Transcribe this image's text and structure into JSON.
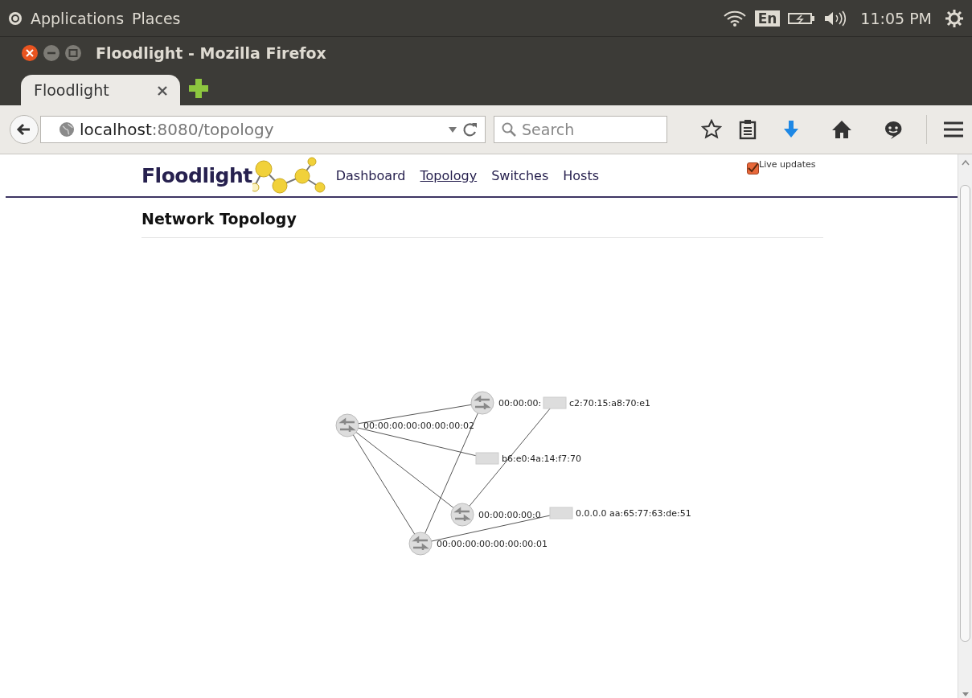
{
  "top_panel": {
    "menus": [
      "Applications",
      "Places"
    ],
    "keyboard": "En",
    "clock": "11:05 PM"
  },
  "window": {
    "title": "Floodlight - Mozilla Firefox"
  },
  "tabs": [
    {
      "label": "Floodlight",
      "selected": true
    }
  ],
  "url_bar": {
    "host": "localhost",
    "path": ":8080/topology"
  },
  "search": {
    "placeholder": "Search"
  },
  "page": {
    "logo": "Floodlight",
    "nav": [
      {
        "label": "Dashboard",
        "selected": false
      },
      {
        "label": "Topology",
        "selected": true
      },
      {
        "label": "Switches",
        "selected": false
      },
      {
        "label": "Hosts",
        "selected": false
      }
    ],
    "live_updates": {
      "label": "Live updates",
      "checked": true
    },
    "heading": "Network Topology",
    "topology": {
      "switches": [
        {
          "label": "00:00:00:00:00:00:00:02"
        },
        {
          "label": "00:00:00:"
        },
        {
          "label": "00:00:00:00:0"
        },
        {
          "label": "00:00:00:00:00:00:00:01"
        }
      ],
      "hosts": [
        {
          "label": "c2:70:15:a8:70:e1"
        },
        {
          "label": "b6:e0:4a:14:f7:70"
        },
        {
          "label": "0.0.0.0 aa:65:77:63:de:51"
        }
      ]
    }
  }
}
